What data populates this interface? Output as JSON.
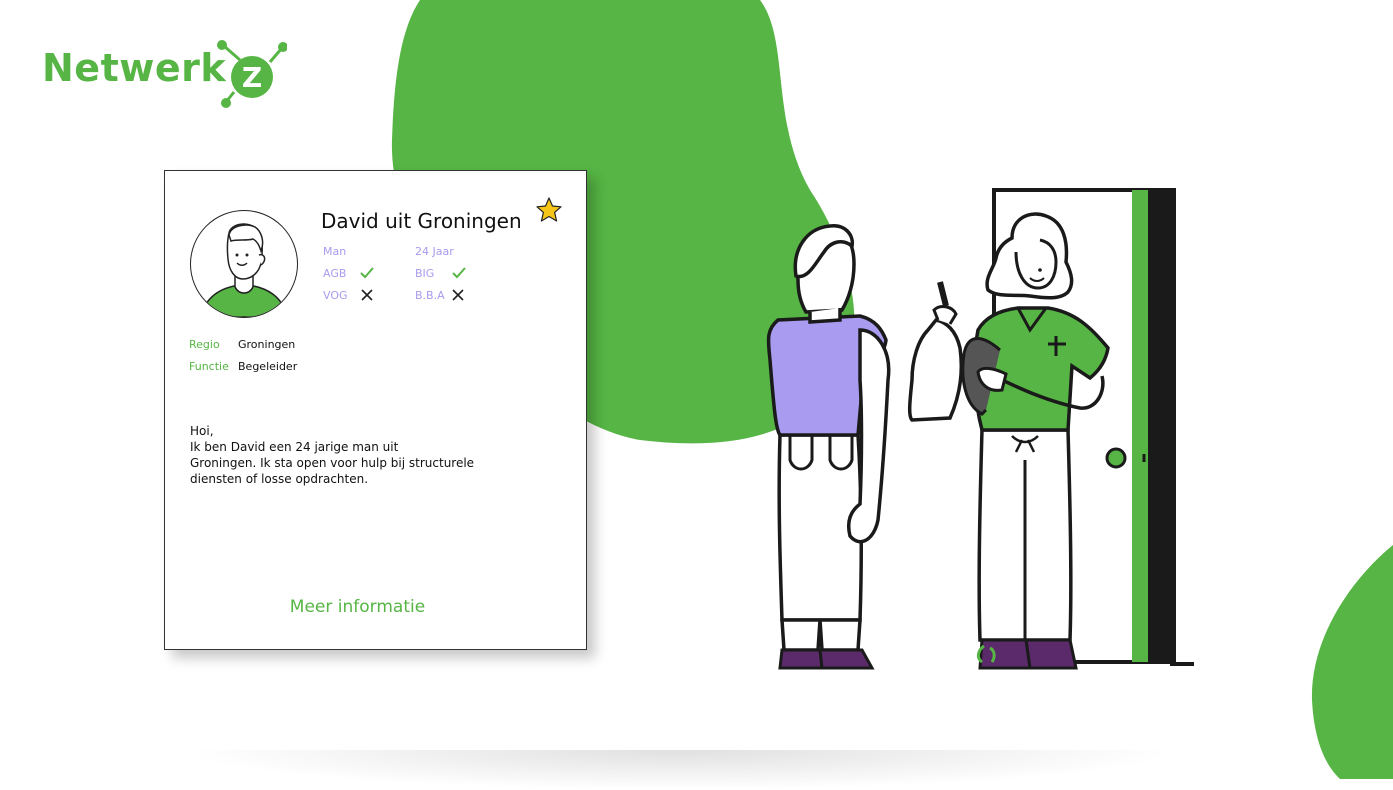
{
  "brand": {
    "name": "Netwerk",
    "mark_letter": "Z",
    "color": "#56b544"
  },
  "profile": {
    "name": "David uit Groningen",
    "favorite_icon": "star-icon",
    "attributes": [
      {
        "label": "Man",
        "status": null
      },
      {
        "label": "24 Jaar",
        "status": null
      },
      {
        "label": "AGB",
        "status": "check"
      },
      {
        "label": "BIG",
        "status": "check"
      },
      {
        "label": "VOG",
        "status": "cross"
      },
      {
        "label": "B.B.A",
        "status": "cross"
      }
    ],
    "regio_label": "Regio",
    "regio_value": "Groningen",
    "functie_label": "Functie",
    "functie_value": "Begeleider",
    "bio_lines": [
      "Hoi,",
      "Ik ben David een 24 jarige man uit",
      "Groningen. Ik sta open voor hulp bij structurele",
      "diensten of losse opdrachten."
    ],
    "more_label": "Meer informatie"
  },
  "colors": {
    "green": "#56b544",
    "purple_text": "#a99bf0",
    "purple_shirt": "#a99bf0",
    "dark": "#1a1a1a"
  }
}
